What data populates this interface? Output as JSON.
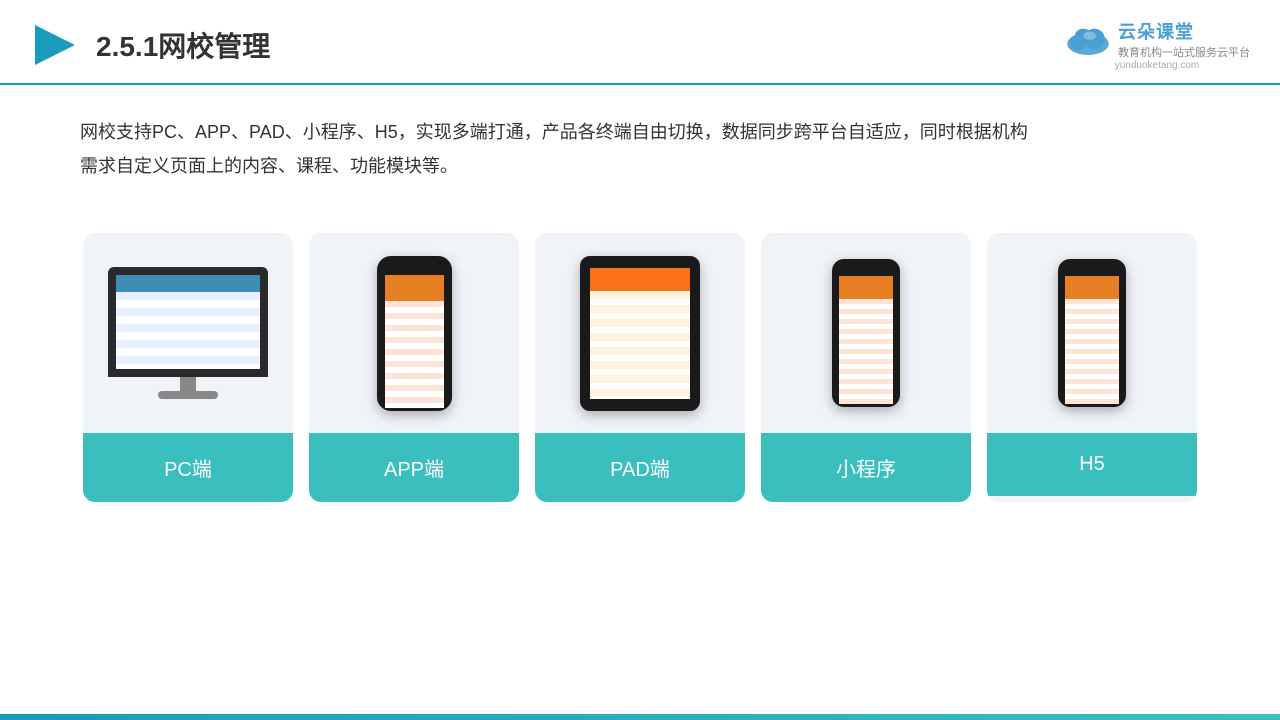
{
  "header": {
    "title": "2.5.1网校管理",
    "logo": {
      "main_text": "云朵课堂",
      "subtitle": "教育机构一站\n式服务云平台",
      "url": "yunduoketang.com"
    }
  },
  "description": "网校支持PC、APP、PAD、小程序、H5，实现多端打通，产品各终端自由切换，数据同步跨平台自适应，同时根据机构\n需求自定义页面上的内容、课程、功能模块等。",
  "cards": [
    {
      "id": "pc",
      "label": "PC端"
    },
    {
      "id": "app",
      "label": "APP端"
    },
    {
      "id": "pad",
      "label": "PAD端"
    },
    {
      "id": "miniprogram",
      "label": "小程序"
    },
    {
      "id": "h5",
      "label": "H5"
    }
  ],
  "accent_color": "#3bbfbe",
  "border_color": "#1a9bbb"
}
